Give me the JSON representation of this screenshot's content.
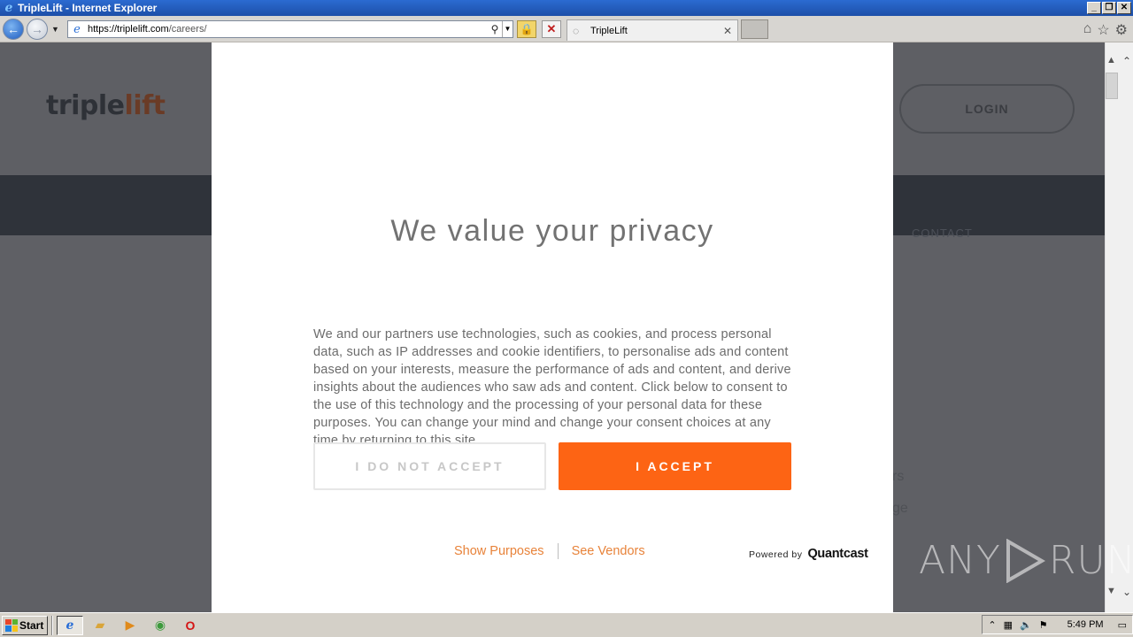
{
  "window": {
    "title": "TripleLift - Internet Explorer",
    "controls": [
      "_",
      "❐",
      "✕"
    ]
  },
  "browser": {
    "url_host": "https://triplelift.com",
    "url_path": "/careers/",
    "tab_label": "TripleLift",
    "tab_close": "✕",
    "back_glyph": "←",
    "forward_glyph": "→",
    "icons": [
      "home-icon",
      "favorites-star-icon",
      "tools-gear-icon"
    ]
  },
  "site": {
    "logo_triple": "triple",
    "logo_lift": "lift",
    "login_label": "LOGIN",
    "nav_contact": "CONTACT",
    "bg_fragment_1": "rs",
    "bg_fragment_2": "ge"
  },
  "consent": {
    "heading": "We value your privacy",
    "body": "We and our partners use technologies, such as cookies, and process personal data, such as IP addresses and cookie identifiers, to personalise ads and content based on your interests, measure the performance of ads and content, and derive insights about the audiences who saw ads and content. Click below to consent to the use of this technology and the processing of your personal data for these purposes. You can change your mind and change your consent choices at any time by returning to this site.",
    "decline_label": "I DO NOT ACCEPT",
    "accept_label": "I ACCEPT",
    "link_purposes": "Show Purposes",
    "link_vendors": "See Vendors",
    "powered_by": "Powered by",
    "brand": "Quantcast",
    "accent_color": "#fd6414"
  },
  "watermark": {
    "left": "ANY",
    "right": "RUN"
  },
  "taskbar": {
    "start_label": "Start",
    "clock": "5:49 PM",
    "pinned": [
      "internet-explorer-icon",
      "folder-icon",
      "media-player-icon",
      "chrome-icon",
      "opera-icon"
    ]
  }
}
